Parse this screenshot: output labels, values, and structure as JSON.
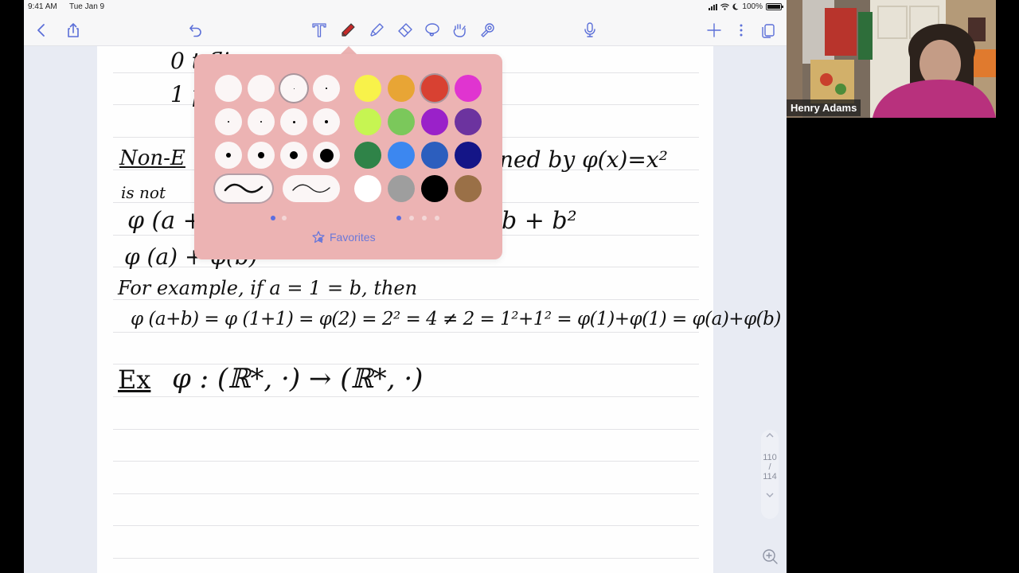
{
  "status_bar": {
    "time": "9:41 AM",
    "date": "Tue Jan 9",
    "battery": "100%",
    "battery_level": 1.0,
    "icons": [
      "cellular-signal-icon",
      "wifi-icon",
      "moon-icon",
      "battery-icon"
    ]
  },
  "toolbar": {
    "left": [
      {
        "name": "back-button",
        "icon": "chevron-left-icon"
      },
      {
        "name": "share-button",
        "icon": "share-icon"
      },
      {
        "name": "undo-button",
        "icon": "undo-icon"
      }
    ],
    "tools": [
      {
        "name": "text-tool",
        "icon": "text-icon"
      },
      {
        "name": "pen-tool",
        "icon": "pen-icon",
        "active": true,
        "color": "#c62828"
      },
      {
        "name": "highlighter-tool",
        "icon": "highlighter-icon"
      },
      {
        "name": "eraser-tool",
        "icon": "eraser-icon"
      },
      {
        "name": "lasso-tool",
        "icon": "lasso-icon"
      },
      {
        "name": "hand-tool",
        "icon": "hand-pointer-icon"
      },
      {
        "name": "laser-pointer-tool",
        "icon": "laser-pointer-icon"
      }
    ],
    "right": [
      {
        "name": "microphone-button",
        "icon": "microphone-icon"
      },
      {
        "name": "add-page-button",
        "icon": "plus-icon"
      },
      {
        "name": "more-button",
        "icon": "more-vertical-icon"
      },
      {
        "name": "pages-button",
        "icon": "pages-icon"
      }
    ]
  },
  "pen_popover": {
    "sizes_rows": [
      [
        "size-1",
        "size-2",
        "size-3",
        "size-4"
      ],
      [
        "size-5",
        "size-6",
        "size-7",
        "size-8"
      ],
      [
        "size-9",
        "size-10",
        "size-11",
        "size-12"
      ]
    ],
    "selected_size": "size-3",
    "stroke_styles": [
      "fountain-pen",
      "ballpoint-pen"
    ],
    "selected_stroke": "fountain-pen",
    "colors": [
      [
        "#f8f24a",
        "#e8a535",
        "#d84132",
        "#e034d0"
      ],
      [
        "#c6f552",
        "#7bc85b",
        "#9a21c9",
        "#6c339f"
      ],
      [
        "#2f8348",
        "#3c87f0",
        "#2c5ebe",
        "#141587"
      ],
      [
        "#ffffff",
        "#9e9e9e",
        "#000000",
        "#9a7047"
      ]
    ],
    "selected_color": "#d84132",
    "size_pages": {
      "count": 2,
      "active": 0
    },
    "color_pages": {
      "count": 4,
      "active": 0
    },
    "favorites_label": "Favorites"
  },
  "note": {
    "lines": [
      {
        "id": "row-0",
        "text": "0                          t      flip"
      },
      {
        "id": "row-1",
        "text": "1                          p      rot"
      },
      {
        "id": "non-example",
        "text": "Non-E",
        "tail": "ned  by  φ(x)=x²"
      },
      {
        "id": "is-not",
        "text": "is  not"
      },
      {
        "id": "phi-a-plus",
        "text": "φ (a +",
        "tail": "b + b²"
      },
      {
        "id": "phi-a-sum",
        "text": "φ (a) + φ(b)"
      },
      {
        "id": "for-example",
        "text": "For  example,  if   a = 1 = b,     then"
      },
      {
        "id": "computation",
        "text": "φ (a+b) = φ (1+1) = φ(2) = 2² = 4 ≠ 2 = 1²+1² = φ(1)+φ(1) = φ(a)+φ(b)"
      },
      {
        "id": "ex-heading",
        "text": "Ex",
        "tail": "φ : (ℝ*, ·) → (ℝ*, ·)"
      }
    ]
  },
  "page_nav": {
    "current": "110",
    "separator": "/",
    "total": "114"
  },
  "video_tile": {
    "participant_name": "Henry Adams"
  }
}
